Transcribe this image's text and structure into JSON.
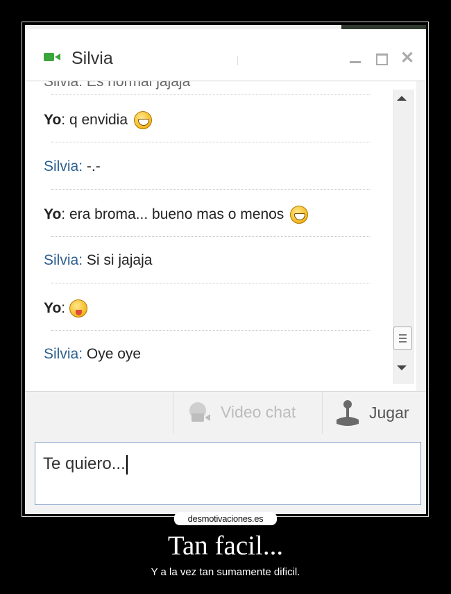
{
  "chat": {
    "title": "Silvia",
    "cut_line": "Silvia: Es normal jajaja",
    "messages": [
      {
        "sender": "Yo",
        "text": "q envidia",
        "emoji": "laughing-emoji"
      },
      {
        "sender": "Silvia",
        "text": "-.-"
      },
      {
        "sender": "Yo",
        "text": "era broma... bueno mas o menos",
        "emoji": "laughing-emoji"
      },
      {
        "sender": "Silvia",
        "text": "Si si jajaja"
      },
      {
        "sender": "Yo",
        "text": "",
        "emoji": "tongue-emoji"
      },
      {
        "sender": "Silvia",
        "text": "Oye oye"
      }
    ],
    "separator": ":",
    "video_chat_label": "Video chat",
    "game_label": "Jugar",
    "input_value": "Te quiero..."
  },
  "poster": {
    "site": "desmotivaciones.es",
    "title": "Tan facil...",
    "subtitle": "Y a la vez tan sumamente dificil."
  },
  "colors": {
    "self_sender": "#222222",
    "other_sender": "#2c5f8e",
    "video_icon": "#3aa53a"
  }
}
